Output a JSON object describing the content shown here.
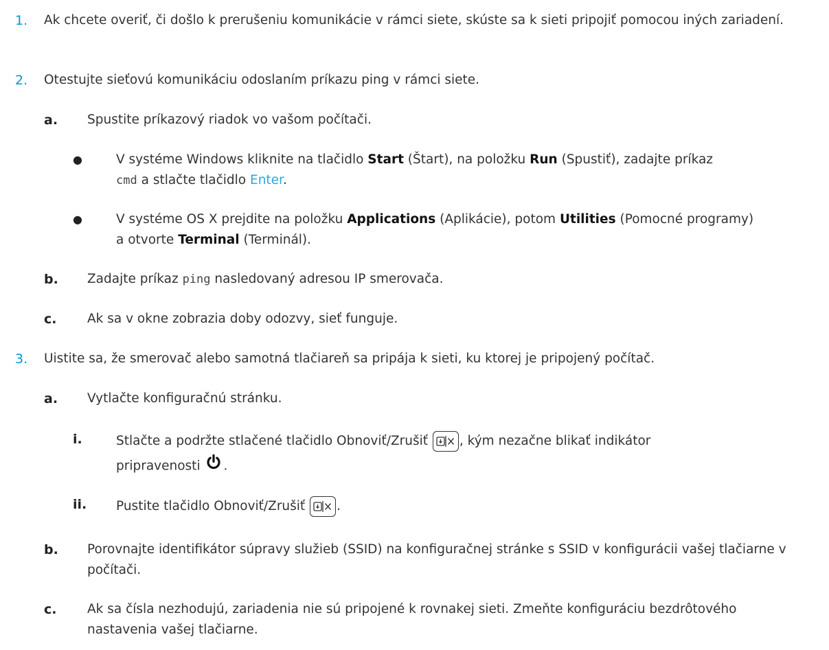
{
  "steps": [
    {
      "number": "1.",
      "text": "Ak chcete overiť, či došlo k prerušeniu komunikácie v rámci siete, skúste sa k sieti pripojiť pomocou iných zariadení."
    },
    {
      "number": "2.",
      "text": "Otestujte sieťovú komunikáciu odoslaním príkazu ping v rámci siete.",
      "substeps": [
        {
          "letter": "a.",
          "text": "Spustite príkazový riadok vo vašom počítači.",
          "bullets": [
            {
              "p1": "V systéme Windows kliknite na tlačidlo ",
              "start": "Start",
              "p2": " (Štart), na položku ",
              "run": "Run",
              "p3": " (Spustiť), zadajte príkaz",
              "cmd": "cmd",
              "p4": " a stlačte tlačidlo ",
              "enter": "Enter",
              "p5": "."
            },
            {
              "p1": "V systéme OS X prejdite na položku ",
              "applications": "Applications",
              "p2": " (Aplikácie), potom ",
              "utilities": "Utilities",
              "p3": " (Pomocné programy)",
              "p4": "a otvorte ",
              "terminal": "Terminal",
              "p5": " (Terminál)."
            }
          ]
        },
        {
          "letter": "b.",
          "p1": "Zadajte príkaz ",
          "ping": "ping",
          "p2": " nasledovaný adresou IP smerovača."
        },
        {
          "letter": "c.",
          "text": "Ak sa v okne zobrazia doby odozvy, sieť funguje."
        }
      ]
    },
    {
      "number": "3.",
      "text": "Uistite sa, že smerovač alebo samotná tlačiareň sa pripája k sieti, ku ktorej je pripojený počítač.",
      "substeps": [
        {
          "letter": "a.",
          "text": "Vytlačte konfiguračnú stránku.",
          "roman": [
            {
              "numeral": "i.",
              "p1": "Stlačte a podržte stlačené tlačidlo Obnoviť/Zrušiť",
              "p2": ", kým nezačne blikať indikátor",
              "p3": "pripravenosti",
              "p4": "."
            },
            {
              "numeral": "ii.",
              "p1": "Pustite tlačidlo Obnoviť/Zrušiť",
              "p2": "."
            }
          ]
        },
        {
          "letter": "b.",
          "text": "Porovnajte identifikátor súpravy služieb (SSID) na konfiguračnej stránke s SSID v konfigurácii vašej tlačiarne v počítači."
        },
        {
          "letter": "c.",
          "text": "Ak sa čísla nezhodujú, zariadenia nie sú pripojené k rovnakej sieti. Zmeňte konfiguráciu bezdrôtového nastavenia vašej tlačiarne."
        }
      ]
    }
  ],
  "icons": {
    "resume_cancel": "resume-cancel-button-icon",
    "ready": "power-ready-icon"
  },
  "colors": {
    "step_number": "#0096d6",
    "link": "#29a8df",
    "text": "#333333"
  }
}
